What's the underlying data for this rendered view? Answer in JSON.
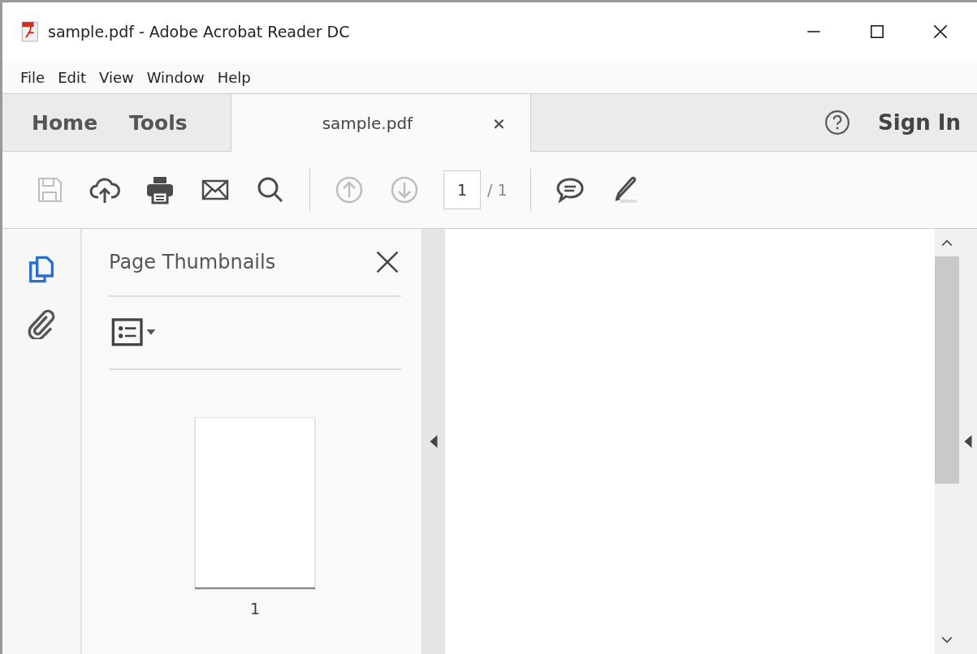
{
  "window": {
    "title": "sample.pdf - Adobe Acrobat Reader DC"
  },
  "menu": [
    "File",
    "Edit",
    "View",
    "Window",
    "Help"
  ],
  "tabs": [
    {
      "label": "Home",
      "kind": "nav",
      "selected": false
    },
    {
      "label": "Tools",
      "kind": "nav",
      "selected": false
    },
    {
      "label": "sample.pdf",
      "kind": "document",
      "selected": true
    }
  ],
  "close_tab": "×",
  "sign_in": "Sign In",
  "toolbar": [
    {
      "kind": "save",
      "disabled": true
    },
    {
      "kind": "upload",
      "disabled": false
    },
    {
      "kind": "print",
      "disabled": false
    },
    {
      "kind": "mail",
      "disabled": false
    },
    {
      "kind": "search",
      "disabled": false
    },
    {
      "kind": "separator"
    },
    {
      "kind": "prev",
      "disabled": true
    },
    {
      "kind": "next",
      "disabled": true
    },
    {
      "kind": "page"
    },
    {
      "kind": "separator"
    },
    {
      "kind": "comment",
      "disabled": false
    },
    {
      "kind": "highlight",
      "disabled": false
    }
  ],
  "page_field": {
    "value": "1",
    "total": "/ 1"
  },
  "side_rail": [
    {
      "kind": "pages",
      "selected": true
    },
    {
      "kind": "attachments",
      "selected": false
    }
  ],
  "panel": {
    "title": "Page Thumbnails",
    "thumbnails": [
      {
        "label": "1"
      }
    ]
  }
}
